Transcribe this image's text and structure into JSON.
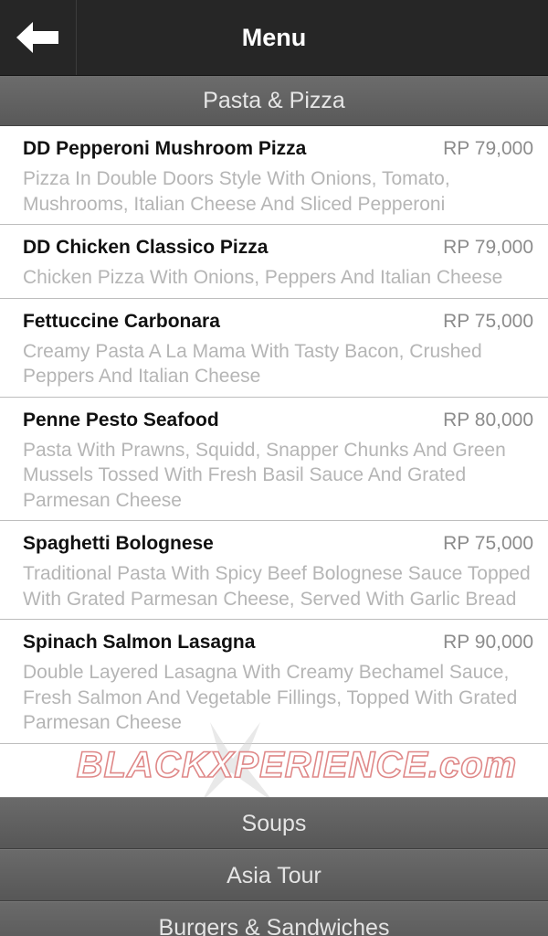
{
  "header": {
    "title": "Menu",
    "back_icon": "arrow-left-icon"
  },
  "section": {
    "title": "Pasta & Pizza"
  },
  "items": [
    {
      "name": "DD Pepperoni Mushroom Pizza",
      "price": "RP 79,000",
      "description": "Pizza In Double Doors Style With Onions, Tomato, Mushrooms, Italian Cheese And Sliced Pepperoni"
    },
    {
      "name": "DD Chicken Classico Pizza",
      "price": "RP 79,000",
      "description": "Chicken Pizza With Onions, Peppers And Italian Cheese"
    },
    {
      "name": "Fettuccine Carbonara",
      "price": "RP 75,000",
      "description": "Creamy Pasta A La Mama With Tasty Bacon, Crushed Peppers And Italian Cheese"
    },
    {
      "name": "Penne Pesto Seafood",
      "price": "RP 80,000",
      "description": "Pasta With Prawns, Squidd, Snapper Chunks And Green Mussels Tossed With Fresh Basil Sauce And Grated Parmesan Cheese"
    },
    {
      "name": "Spaghetti Bolognese",
      "price": "RP 75,000",
      "description": "Traditional Pasta With Spicy Beef Bolognese Sauce Topped With Grated Parmesan Cheese, Served With Garlic Bread"
    },
    {
      "name": "Spinach Salmon Lasagna",
      "price": "RP 90,000",
      "description": "Double Layered Lasagna With Creamy Bechamel Sauce, Fresh Salmon And Vegetable Fillings, Topped With Grated Parmesan Cheese"
    }
  ],
  "categories": [
    {
      "label": "Soups"
    },
    {
      "label": "Asia Tour"
    },
    {
      "label": "Burgers & Sandwiches"
    }
  ],
  "watermark": {
    "text": "BLACKXPERIENCE.com"
  },
  "colors": {
    "topbar": "#262626",
    "section_bar": "#626262",
    "item_name": "#111111",
    "item_price": "#8c8c8c",
    "item_desc": "#b5b5b5"
  }
}
